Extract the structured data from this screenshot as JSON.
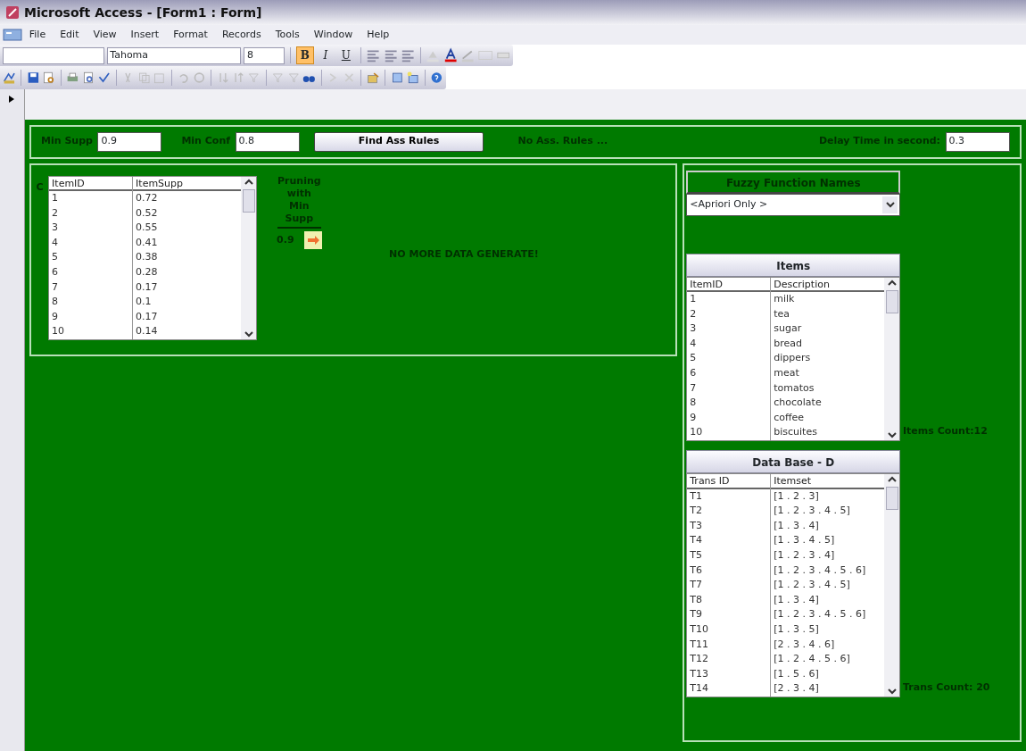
{
  "window": {
    "title": "Microsoft Access - [Form1 : Form]"
  },
  "menu": [
    "File",
    "Edit",
    "View",
    "Insert",
    "Format",
    "Records",
    "Tools",
    "Window",
    "Help"
  ],
  "formatting_toolbar": {
    "font": "Tahoma",
    "size": "8",
    "style_buttons": [
      {
        "label": "B",
        "selected": true
      },
      {
        "label": "I",
        "selected": false
      },
      {
        "label": "U",
        "selected": false
      }
    ]
  },
  "top_strip": {
    "min_supp": {
      "label": "Min Supp",
      "value": "0.9"
    },
    "min_conf": {
      "label": "Min Conf",
      "value": "0.8"
    },
    "find_button": "Find Ass Rules",
    "status": "No Ass. Rules ...",
    "delay": {
      "label": "Delay Time in second:",
      "value": "0.3"
    }
  },
  "left_panel": {
    "caption": "C",
    "table": {
      "columns": [
        "ItemID",
        "ItemSupp"
      ],
      "rows": [
        [
          "1",
          "0.72"
        ],
        [
          "2",
          "0.52"
        ],
        [
          "3",
          "0.55"
        ],
        [
          "4",
          "0.41"
        ],
        [
          "5",
          "0.38"
        ],
        [
          "6",
          "0.28"
        ],
        [
          "7",
          "0.17"
        ],
        [
          "8",
          "0.1"
        ],
        [
          "9",
          "0.17"
        ],
        [
          "10",
          "0.14"
        ]
      ]
    },
    "pruning_label": [
      "Pruning",
      "with",
      "Min",
      "Supp"
    ],
    "pruning_value": "0.9",
    "message": "NO MORE DATA GENERATE!"
  },
  "right_panel": {
    "fuzzy_header": "Fuzzy Function Names",
    "fuzzy_combo": "<Apriori Only >",
    "items": {
      "title": "Items",
      "columns": [
        "ItemID",
        "Description"
      ],
      "rows": [
        [
          "1",
          "milk"
        ],
        [
          "2",
          "tea"
        ],
        [
          "3",
          "sugar"
        ],
        [
          "4",
          "bread"
        ],
        [
          "5",
          "dippers"
        ],
        [
          "6",
          "meat"
        ],
        [
          "7",
          "tomatos"
        ],
        [
          "8",
          "chocolate"
        ],
        [
          "9",
          "coffee"
        ],
        [
          "10",
          "biscuites"
        ]
      ],
      "count": "Items Count:12"
    },
    "database": {
      "title": "Data Base - D",
      "columns": [
        "Trans ID",
        "Itemset"
      ],
      "rows": [
        [
          "T1",
          "[1 . 2 . 3]"
        ],
        [
          "T2",
          "[1 . 2 . 3 . 4 . 5]"
        ],
        [
          "T3",
          "[1 . 3 . 4]"
        ],
        [
          "T4",
          "[1 . 3 . 4 . 5]"
        ],
        [
          "T5",
          "[1 . 2 . 3 . 4]"
        ],
        [
          "T6",
          "[1 . 2 . 3 . 4 . 5 . 6]"
        ],
        [
          "T7",
          "[1 . 2 . 3 . 4 . 5]"
        ],
        [
          "T8",
          "[1 . 3 . 4]"
        ],
        [
          "T9",
          "[1 . 2 . 3 . 4 . 5 . 6]"
        ],
        [
          "T10",
          "[1 . 3 . 5]"
        ],
        [
          "T11",
          "[2 . 3 . 4 . 6]"
        ],
        [
          "T12",
          "[1 . 2 . 4 . 5 . 6]"
        ],
        [
          "T13",
          "[1 . 5 . 6]"
        ],
        [
          "T14",
          "[2 . 3 . 4]"
        ]
      ],
      "count": "Trans Count: 20"
    }
  }
}
